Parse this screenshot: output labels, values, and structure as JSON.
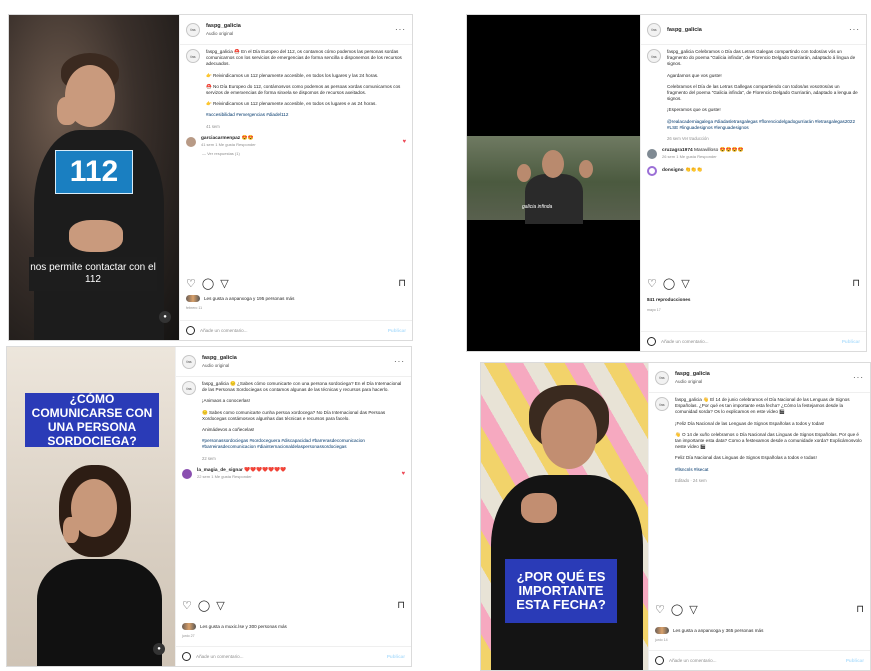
{
  "posts": [
    {
      "username": "faspg_galicia",
      "audio": "Audio original",
      "caption_p1": "faspg_galicia ⛑️ En el Día Europeo del 112, os contamos cómo podemos las personas sordas comunicarnos con los servicios de emergencias de forma sencilla o disponemos de los recursos adecuados.",
      "caption_p2": "👉 Reivindicamos un 112 plenamente accesible, en todos los lugares y las 24 horas.",
      "caption_p3": "⛑️ No Día Europeo do 112, contámosvos como podemos as persoas xordas comunicarnos cos servizos de emerxencias de forma sinxela se dispomos de recursos axeitados.",
      "caption_p4": "👉 Reivindicamos un 112 plenamente accesible, en todos os lugares e as 24 horas.",
      "hashtags": "#accesibilidad #emergencias #diadel112",
      "time": "41 sem",
      "comment_user": "garciacarmenpaz",
      "comment_text": "😍😍",
      "comment_meta": "41 sem   1 Me gusta   Responder",
      "replies": "— Ver respuestas (1)",
      "likes": "Les gusta a anpanxoga y 195 personas más",
      "date": "febrero 11",
      "add_comment": "Añade un comentario...",
      "publish": "Publicar",
      "overlay_number": "112",
      "overlay_caption": "nos permite contactar con el 112"
    },
    {
      "username": "faspg_galicia",
      "caption_p1": "faspg_galicia Celebramos o Día das Letras Galegas compartindo con todos/as vós un fragmento do poema \"Galicia infinda\", de Florencio Delgado Gurriarán, adaptado á lingua de signos.",
      "caption_p2": "Agardamos que vos guste!",
      "caption_p3": "Celebramos el Día de las Letras Gallegas compartiendo con todos/as vosotros/as un fragmento del poema \"Galicia infinda\", de Florencio Delgado Gurriarán, adaptado a lengua de signos.",
      "caption_p4": "¡Esperamos que os guste!",
      "hashtags": "@realacademiagalega #diadasletrasgalegas #florenciodelgadogurriarán #letrasgalegas2022 #LSE #linguadesignos #lenguadesignos",
      "time": "26 sem   Ver traducción",
      "subtitle": "galicia infinda",
      "comment1_user": "cruzagra1974",
      "comment1_text": "Maravilloso 😍😍😍😍",
      "comment1_meta": "26 sem   1 Me gusta   Responder",
      "comment2_user": "donsigno",
      "comment2_text": "👏👏👏",
      "views": "841 reproducciones",
      "date": "mayo 17",
      "add_comment": "Añade un comentario...",
      "publish": "Publicar"
    },
    {
      "username": "faspg_galicia",
      "audio": "Audio original",
      "caption_p1": "faspg_galicia 😔 ¿Sabes cómo comunicarte con una persona sordociega? En el Día Internacional de las Personas Sordociegas os contamos algunas de las técnicas y recursos para hacerlo.",
      "caption_p2": "¡Animaos a conocerlas!",
      "caption_p3": "😔 Sabes como comunicarte cunha persoa xordocega? No Día Internacional das Persoas Xordocegas contámosvos algunhas das técnicas e recursos para facelo.",
      "caption_p4": "Animádevos a coñecelas!",
      "hashtags": "#personassordociegas #sordoceguera #discapacidad #barrerasdecomunicacion #barreirasdecomunicacion #diainternacionaldelaspersonassordociegas",
      "time": "22 sem",
      "comment_user": "la_magia_de_signar",
      "comment_text": "❤️❤️❤️❤️❤️❤️❤️",
      "comment_meta": "22 sem   1 Me gusta   Responder",
      "likes": "Les gusta a muxic.lse y 300 personas más",
      "date": "junio 27",
      "add_comment": "Añade un comentario...",
      "publish": "Publicar",
      "overlay": "¿CÓMO COMUNICARSE CON UNA PERSONA SORDOCIEGA?"
    },
    {
      "username": "faspg_galicia",
      "audio": "Audio original",
      "caption_p1": "faspg_galicia 👋 El 14 de junio celebramos el Día Nacional de las Lenguas de Signos Españolas. ¿Por qué es tan importante esta fecha? ¿Cómo la festejamos desde la comunidad sorda? Os lo explicamos en este vídeo 🎬",
      "caption_p2": "¡Feliz Día Nacional de las Lenguas de Signos Españolas a todos y todas!",
      "caption_p3": "👋 O 14 de xuño celebramos o Día Nacional das Linguas de Signos Españolas. Por que é tan importante esta data? Como a festexamos desde a comunidade xorda? Explicámosvolo neste vídeo 🎬",
      "caption_p4": "Feliz Día Nacional das Linguas de Signos Españolas a todos e todas!",
      "hashtags": "#llsncnls #lsecat",
      "time": "Editado · 24 sem",
      "likes": "Les gusta a anpanxoga y 365 personas más",
      "date": "junio 14",
      "add_comment": "Añade un comentario...",
      "publish": "Publicar",
      "overlay": "¿POR QUÉ ES IMPORTANTE ESTA FECHA?"
    }
  ],
  "icons": [
    "heart-icon",
    "comment-icon",
    "share-icon",
    "save-icon",
    "more-icon",
    "emoji-icon"
  ],
  "colors": {
    "accent_blue": "#1a7fc1",
    "overlay_blue": "#2a3bb7",
    "like_red": "#ed4956",
    "link": "#00376b"
  }
}
